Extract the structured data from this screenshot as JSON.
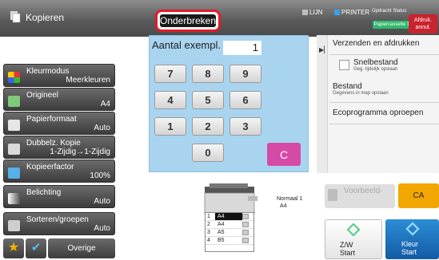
{
  "header": {
    "title": "Kopieren",
    "interrupt_label": "Onderbreken",
    "line_label": "LIJN",
    "printer_label": "PRINTER",
    "job_status_label": "Opdracht Status",
    "paper_badge": "Papiercassette 1",
    "cancel_print_label": "Afdruk. annul."
  },
  "functions": [
    {
      "label": "Kleurmodus",
      "value": "Meerkleuren",
      "icon": "color-mode-icon"
    },
    {
      "label": "Origineel",
      "value": "A4",
      "icon": "original-icon"
    },
    {
      "label": "Papierformaat",
      "value": "Auto",
      "icon": "paper-size-icon"
    },
    {
      "label": "Dubbelz. Kopie",
      "value": "1-Zijdig→1-Zijdig",
      "icon": "duplex-icon"
    },
    {
      "label": "Kopieerfactor",
      "value": "100%",
      "icon": "zoom-icon"
    },
    {
      "label": "Belichting",
      "value": "Auto",
      "icon": "exposure-icon"
    },
    {
      "label": "Sorteren/groepen",
      "value": "Auto",
      "icon": "sort-icon"
    }
  ],
  "bottom_left": {
    "other_label": "Overige"
  },
  "keypad": {
    "copies_label": "Aantal exempl.",
    "copies_value": "1",
    "keys": [
      "7",
      "8",
      "9",
      "4",
      "5",
      "6",
      "1",
      "2",
      "3",
      "0"
    ],
    "clear_label": "C"
  },
  "right_panel": {
    "send_print": "Verzenden en afdrukken",
    "quick_file": "Snelbestand",
    "quick_file_sub": "Geg. tijdelijk opslaan",
    "file": "Bestand",
    "file_sub": "Gegevens in map opslaan",
    "eco": "Ecoprogramma oproepen"
  },
  "preview": {
    "preview_label": "Voorbeeld-",
    "ca_label": "CA",
    "original_mode": "Normaal 1",
    "original_size": "A4",
    "bw_start_line1": "Z/W",
    "bw_start_line2": "Start",
    "color_start_line1": "Kleur",
    "color_start_line2": "Start"
  },
  "trays": [
    {
      "n": "1",
      "size": "A4",
      "selected": true
    },
    {
      "n": "2",
      "size": "A4",
      "selected": false
    },
    {
      "n": "3",
      "size": "A5",
      "selected": false
    },
    {
      "n": "4",
      "size": "B5",
      "selected": false
    }
  ],
  "colors": {
    "interrupt_border": "#e21a2a",
    "keypad_bg": "#a8d4f0",
    "clear_key": "#d64aa7",
    "ca_button": "#f2a600",
    "color_start": "#145aa5",
    "printer_indicator": "#3aa0e8"
  }
}
